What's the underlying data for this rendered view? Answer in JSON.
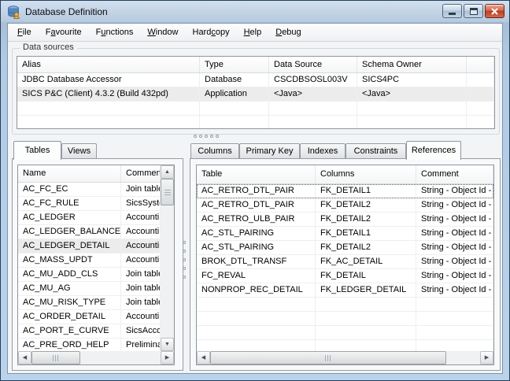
{
  "window": {
    "title": "Database Definition"
  },
  "menu": {
    "items": [
      {
        "pre": "",
        "key": "F",
        "post": "ile"
      },
      {
        "pre": "F",
        "key": "a",
        "post": "vourite"
      },
      {
        "pre": "F",
        "key": "u",
        "post": "nctions"
      },
      {
        "pre": "",
        "key": "W",
        "post": "indow"
      },
      {
        "pre": "Hard",
        "key": "c",
        "post": "opy"
      },
      {
        "pre": "",
        "key": "H",
        "post": "elp"
      },
      {
        "pre": "",
        "key": "D",
        "post": "ebug"
      }
    ]
  },
  "datasources": {
    "label": "Data sources",
    "columns": [
      "Alias",
      "Type",
      "Data Source",
      "Schema Owner"
    ],
    "rows": [
      {
        "alias": "JDBC Database Accessor",
        "type": "Database",
        "source": "CSCDBSOSL003V",
        "owner": "SICS4PC"
      },
      {
        "alias": "SICS P&C (Client) 4.3.2  (Build 432pd)",
        "type": "Application",
        "source": "<Java>",
        "owner": "<Java>"
      }
    ]
  },
  "tables_panel": {
    "tabs": [
      "Tables",
      "Views"
    ],
    "active_tab": "Tables",
    "columns": [
      "Name",
      "Comment"
    ],
    "rows": [
      {
        "name": "AC_FC_EC",
        "comment": "Join table"
      },
      {
        "name": "AC_FC_RULE",
        "comment": "SicsSyste"
      },
      {
        "name": "AC_LEDGER",
        "comment": "Accountin"
      },
      {
        "name": "AC_LEDGER_BALANCE",
        "comment": "Accountin"
      },
      {
        "name": "AC_LEDGER_DETAIL",
        "comment": "Accountin"
      },
      {
        "name": "AC_MASS_UPDT",
        "comment": "Accountin"
      },
      {
        "name": "AC_MU_ADD_CLS",
        "comment": "Join table"
      },
      {
        "name": "AC_MU_AG",
        "comment": "Join table"
      },
      {
        "name": "AC_MU_RISK_TYPE",
        "comment": "Join table"
      },
      {
        "name": "AC_ORDER_DETAIL",
        "comment": "Accountin"
      },
      {
        "name": "AC_PORT_E_CURVE",
        "comment": "SicsAccou"
      },
      {
        "name": "AC_PRE_ORD_HELP",
        "comment": "Preliminar"
      }
    ]
  },
  "details_panel": {
    "tabs": [
      "Columns",
      "Primary Key",
      "Indexes",
      "Constraints",
      "References"
    ],
    "active_tab": "References",
    "columns": [
      "Table",
      "Columns",
      "Comment"
    ],
    "rows": [
      {
        "table": "AC_RETRO_DTL_PAIR",
        "columns": "FK_DETAIL1",
        "comment": "String - Object Id -"
      },
      {
        "table": "AC_RETRO_DTL_PAIR",
        "columns": "FK_DETAIL2",
        "comment": "String - Object Id -"
      },
      {
        "table": "AC_RETRO_ULB_PAIR",
        "columns": "FK_DETAIL2",
        "comment": "String - Object Id -"
      },
      {
        "table": "AC_STL_PAIRING",
        "columns": "FK_DETAIL1",
        "comment": "String - Object Id -"
      },
      {
        "table": "AC_STL_PAIRING",
        "columns": "FK_DETAIL2",
        "comment": "String - Object Id -"
      },
      {
        "table": "BROK_DTL_TRANSF",
        "columns": "FK_AC_DETAIL",
        "comment": "String - Object Id -"
      },
      {
        "table": "FC_REVAL",
        "columns": "FK_DETAIL",
        "comment": "String - Object Id -"
      },
      {
        "table": "NONPROP_REC_DETAIL",
        "columns": "FK_LEDGER_DETAIL",
        "comment": "String - Object Id -"
      }
    ]
  }
}
